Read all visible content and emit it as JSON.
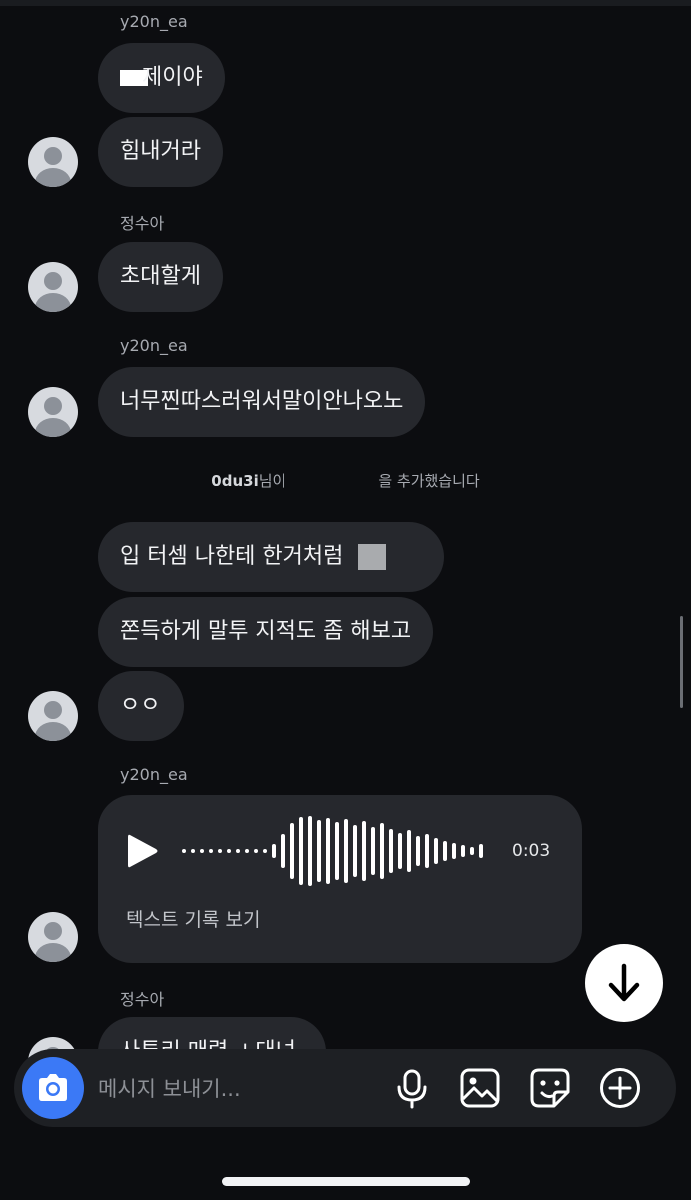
{
  "messages": {
    "group1": {
      "sender": "y20n_ea",
      "bubble1": "제이야",
      "bubble2": "힘내거라"
    },
    "group2": {
      "sender": "정수아",
      "bubble1": "초대할게"
    },
    "group3": {
      "sender": "y20n_ea",
      "bubble1": "너무찐따스러워서말이안나오노"
    },
    "system": {
      "user": "0du3i",
      "prefix": "님이",
      "suffix": "을 추가했습니다"
    },
    "group4": {
      "bubble1": "입 터셈 나한테 한거처럼",
      "bubble2": "쫀득하게 말투 지적도 좀 해보고",
      "bubble3": "ㅇㅇ"
    },
    "group5": {
      "sender": "y20n_ea",
      "voice_duration": "0:03",
      "voice_transcript_link": "텍스트 기록 보기"
    },
    "group6": {
      "sender": "정수아",
      "bubble_partial": "사투리 매력 ㅗ대녀"
    }
  },
  "composer": {
    "placeholder": "메시지 보내기..."
  },
  "icons": {
    "camera": "camera-icon",
    "mic": "microphone-icon",
    "gallery": "image-icon",
    "sticker": "sticker-icon",
    "plus": "plus-icon",
    "scroll_down": "arrow-down-icon",
    "play": "play-icon"
  },
  "colors": {
    "background": "#0c0d10",
    "bubble": "#26282d",
    "accent": "#3b79f6"
  }
}
